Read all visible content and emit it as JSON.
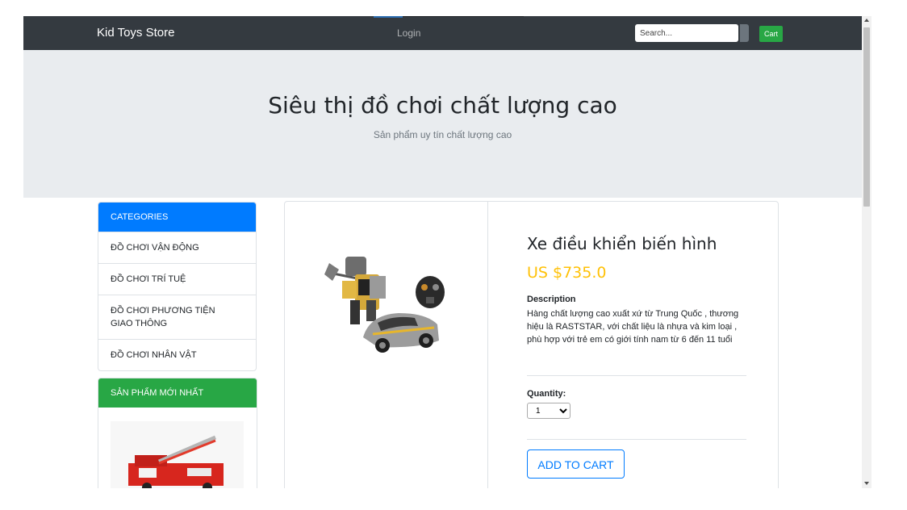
{
  "navbar": {
    "brand": "Kid Toys Store",
    "login": "Login",
    "search_placeholder": "Search...",
    "cart": "Cart"
  },
  "jumbotron": {
    "title": "Siêu thị đồ chơi chất lượng cao",
    "subtitle": "Sản phẩm uy tín chất lượng cao"
  },
  "categories": {
    "header": "CATEGORIES",
    "items": [
      {
        "label": "ĐỒ CHƠI VẬN ĐỘNG"
      },
      {
        "label": "ĐỒ CHƠI TRÍ TUỆ"
      },
      {
        "label": "ĐỒ CHƠI PHƯƠNG TIỆN GIAO THÔNG"
      },
      {
        "label": "ĐỒ CHƠI NHÂN VẬT"
      }
    ]
  },
  "newest": {
    "header": "SẢN PHẨM MỚI NHẤT"
  },
  "product": {
    "name": "Xe điều khiển biến hình",
    "price": "US $735.0",
    "description_label": "Description",
    "description": "Hàng chất lượng cao xuất xứ từ Trung Quốc , thương hiệu là RASTSTAR, với chất liệu là nhựa và kim loại , phù hợp với trẻ em có giới tính nam từ 6 đến 11 tuổi",
    "quantity_label": "Quantity:",
    "quantity_value": "1",
    "add_to_cart": "ADD TO CART"
  },
  "colors": {
    "navbar": "#343a40",
    "primary": "#007bff",
    "success": "#28a745",
    "price": "#ffc107",
    "jumbotron": "#e9ecef"
  }
}
